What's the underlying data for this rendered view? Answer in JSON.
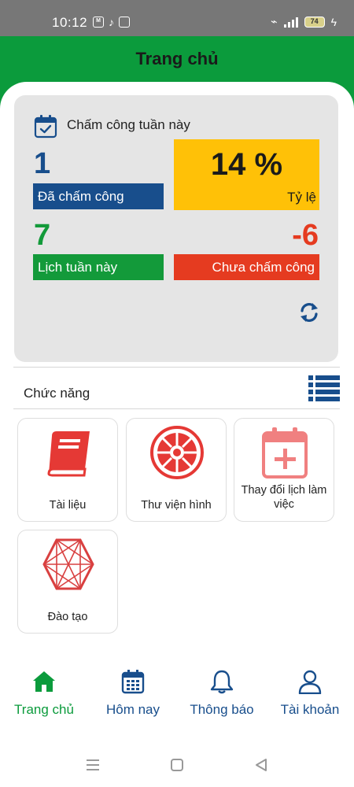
{
  "status_bar": {
    "time": "10:12",
    "battery": "74"
  },
  "header": {
    "title": "Trang chủ"
  },
  "summary": {
    "title": "Chấm công tuần này",
    "checked_in": {
      "value": "1",
      "label": "Đã chấm công"
    },
    "ratio": {
      "value": "14 %",
      "label": "Tỷ lệ"
    },
    "scheduled": {
      "value": "7",
      "label": "Lịch tuần này"
    },
    "not_checked": {
      "value": "-6",
      "label": "Chưa chấm công"
    }
  },
  "functions": {
    "title": "Chức năng",
    "items": [
      {
        "label": "Tài liệu",
        "icon": "book-icon"
      },
      {
        "label": "Thư viện hình",
        "icon": "gallery-emblem-icon"
      },
      {
        "label": "Thay đổi lịch làm việc",
        "icon": "calendar-add-icon"
      },
      {
        "label": "Đào tạo",
        "icon": "training-network-icon"
      }
    ]
  },
  "bottom_nav": [
    {
      "label": "Trang chủ",
      "icon": "home-icon",
      "active": true
    },
    {
      "label": "Hôm nay",
      "icon": "calendar-icon",
      "active": false
    },
    {
      "label": "Thông báo",
      "icon": "bell-icon",
      "active": false
    },
    {
      "label": "Tài khoản",
      "icon": "user-icon",
      "active": false
    }
  ],
  "colors": {
    "brand_green": "#0b9b3c",
    "nav_blue": "#184e8c",
    "yellow": "#ffc107",
    "red": "#e53b20",
    "icon_red": "#e53935"
  }
}
